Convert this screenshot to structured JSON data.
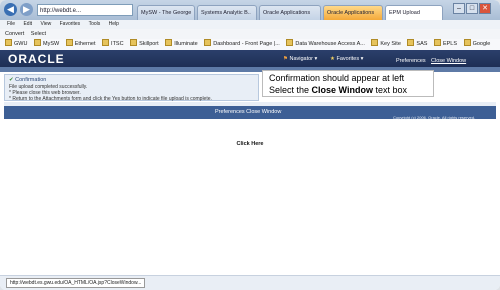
{
  "browser": {
    "address": "http://webdt.e...",
    "tabs": [
      {
        "label": "MySW - The George"
      },
      {
        "label": "Systems Analytic B.."
      },
      {
        "label": "Oracle Applications"
      },
      {
        "label": "Oracle Applications"
      },
      {
        "label": "EPM Upload"
      }
    ],
    "menu": [
      "File",
      "Edit",
      "View",
      "Favorites",
      "Tools",
      "Help"
    ],
    "toolbar": [
      "Convert",
      "Select"
    ],
    "favorites": [
      "GWU",
      "MySW",
      "Ethernet",
      "ITSC",
      "Skillport",
      "Illuminate",
      "Dashboard - Front Page |...",
      "Data Warehouse Access A...",
      "Key Site",
      "SAS",
      "EPLS",
      "Google"
    ],
    "status_url": "http://webdt.es.gwu.edu/OA_HTML/OA.jsp?CloseWindow..."
  },
  "oracle": {
    "logo": "ORACLE",
    "navigator": "Navigator",
    "favorites": "Favorites",
    "preferences": "Preferences",
    "close_window": "Close Window"
  },
  "confirmation": {
    "title": "Confirmation",
    "lines": [
      "File upload completed successfully.",
      "* Please close this web browser.",
      "* Return to the Attachments form and click the Yes button to indicate file upload is complete."
    ]
  },
  "callout": {
    "line1": "Confirmation should appear at left",
    "line2_prefix": "Select the",
    "line2_bold": "Close Window",
    "line2_suffix": "text box"
  },
  "footer": {
    "links": "Preferences   Close Window",
    "copyright": "Copyright (c) 2006, Oracle. All rights reserved."
  },
  "click_here": "Click Here"
}
